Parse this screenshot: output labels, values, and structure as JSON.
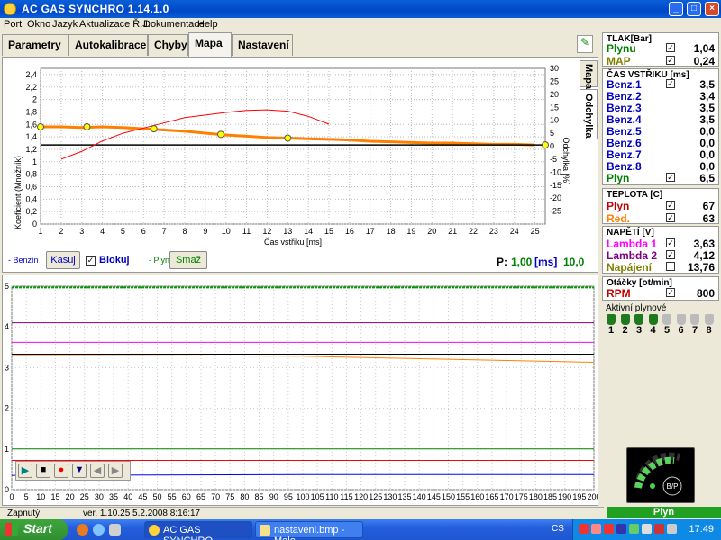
{
  "window": {
    "title": "AC GAS SYNCHRO    1.14.1.0"
  },
  "menu": [
    "Port",
    "Okno",
    "Jazyk",
    "Aktualizace Ř.J.",
    "Dokumentace",
    "Help"
  ],
  "tabs": [
    {
      "label": "Parametry",
      "active": false
    },
    {
      "label": "Autokalibrace",
      "active": false
    },
    {
      "label": "Chyby",
      "active": false
    },
    {
      "label": "Mapa",
      "active": true
    },
    {
      "label": "Nastavení",
      "active": false
    }
  ],
  "side_tabs": [
    "Mapa",
    "Odchylka"
  ],
  "map": {
    "y_label": "Koeficient (Množník)",
    "y2_label": "Odchylka [%]",
    "x_label": "Čas vstřiku [ms]",
    "y_ticks": [
      "2,4",
      "2,2",
      "2",
      "1,8",
      "1,6",
      "1,4",
      "1,2",
      "1",
      "0,8",
      "0,6",
      "0,4",
      "0,2",
      "0"
    ],
    "y2_ticks": [
      "30",
      "25",
      "20",
      "15",
      "10",
      "5",
      "0",
      "-5",
      "-10",
      "-15",
      "-20",
      "-25"
    ],
    "x_ticks": [
      "1",
      "2",
      "3",
      "4",
      "5",
      "6",
      "7",
      "8",
      "9",
      "10",
      "11",
      "12",
      "13",
      "14",
      "15",
      "16",
      "17",
      "18",
      "19",
      "20",
      "21",
      "22",
      "23",
      "24",
      "25"
    ],
    "benzin_label": "- Benzín",
    "kasuj_label": "Kasuj",
    "blokuj_label": "Blokuj",
    "plyn_label": "- Plyn",
    "smaz_label": "Smaž",
    "readout_label": "P:",
    "readout_value": "1,00",
    "readout_unit": "[ms]",
    "readout_value2": "10,0"
  },
  "chart_data": [
    {
      "type": "line",
      "xlabel": "Čas vstřiku [ms]",
      "ylabel": "Koeficient (Množník)",
      "y2label": "Odchylka [%]",
      "xlim": [
        1,
        25.5
      ],
      "ylim": [
        0,
        2.5
      ],
      "y2lim": [
        -30,
        30
      ],
      "grid": true,
      "series": [
        {
          "axis": "y",
          "color": "#ff8000",
          "x": [
            1,
            2,
            3,
            4,
            5,
            6,
            7,
            8,
            9,
            10,
            11,
            12,
            13,
            14,
            15,
            16,
            17,
            18,
            19,
            20,
            21,
            22,
            23,
            24,
            25
          ],
          "y": [
            1.56,
            1.56,
            1.55,
            1.56,
            1.55,
            1.53,
            1.51,
            1.49,
            1.46,
            1.43,
            1.41,
            1.39,
            1.38,
            1.37,
            1.36,
            1.35,
            1.33,
            1.32,
            1.31,
            1.3,
            1.3,
            1.29,
            1.28,
            1.28,
            1.27
          ]
        },
        {
          "axis": "y",
          "color": "#000000",
          "x": [
            1,
            25.5
          ],
          "y": [
            1.27,
            1.27
          ]
        },
        {
          "axis": "y2",
          "color": "#ff0000",
          "x": [
            2,
            3,
            4,
            5,
            6,
            7,
            8,
            9,
            10,
            11,
            12,
            13,
            14,
            15
          ],
          "y": [
            -5,
            -2,
            2,
            5,
            7,
            9,
            11,
            12,
            13,
            13.8,
            14,
            13.5,
            11.5,
            8.5
          ]
        }
      ],
      "points": [
        {
          "x": 1,
          "y": 1.56
        },
        {
          "x": 3.25,
          "y": 1.56
        },
        {
          "x": 6.5,
          "y": 1.53
        },
        {
          "x": 9.75,
          "y": 1.44
        },
        {
          "x": 13,
          "y": 1.38
        },
        {
          "x": 25.5,
          "y": 1.27
        }
      ]
    },
    {
      "type": "line",
      "ylim": [
        0,
        5
      ],
      "xlim": [
        0,
        200
      ],
      "x_ticks": [
        "0",
        "5",
        "10",
        "15",
        "20",
        "25",
        "30",
        "35",
        "40",
        "45",
        "50",
        "55",
        "60",
        "65",
        "70",
        "75",
        "80",
        "85",
        "90",
        "95",
        "100",
        "105",
        "110",
        "115",
        "120",
        "125",
        "130",
        "135",
        "140",
        "145",
        "150",
        "155",
        "160",
        "165",
        "170",
        "175",
        "180",
        "185",
        "190",
        "195",
        "200"
      ],
      "y_ticks": [
        "5",
        "4",
        "3",
        "2",
        "1",
        "0"
      ],
      "series": [
        {
          "color": "#800080",
          "values": [
            4.1,
            4.1,
            4.1
          ]
        },
        {
          "color": "#ff00ff",
          "values": [
            3.62,
            3.62,
            3.62
          ]
        },
        {
          "color": "#000000",
          "values": [
            3.33,
            3.33,
            3.33
          ]
        },
        {
          "color": "#ff8000",
          "values": [
            3.3,
            3.28,
            3.13
          ]
        },
        {
          "color": "#008000",
          "values": [
            1.0,
            1.0,
            1.0
          ]
        },
        {
          "color": "#ff0000",
          "values": [
            0.72,
            0.72,
            0.72
          ]
        },
        {
          "color": "#0000ff",
          "values": [
            0.35,
            0.37,
            0.37
          ]
        },
        {
          "color": "#00a000",
          "values": [
            4.97,
            4.97,
            4.97
          ]
        }
      ]
    }
  ],
  "tlak": {
    "header": "TLAK[Bar]",
    "rows": [
      {
        "label": "Plynu",
        "color": "#008000",
        "checked": true,
        "value": "1,04"
      },
      {
        "label": "MAP",
        "color": "#808000",
        "checked": true,
        "value": "0,24"
      }
    ]
  },
  "cas": {
    "header": "ČAS VSTŘIKU  [ms]",
    "rows": [
      {
        "label": "Benz.1",
        "color": "#0000c0",
        "checked": true,
        "value": "3,5"
      },
      {
        "label": "Benz.2",
        "color": "#0000c0",
        "checked": null,
        "value": "3,4"
      },
      {
        "label": "Benz.3",
        "color": "#0000c0",
        "checked": null,
        "value": "3,5"
      },
      {
        "label": "Benz.4",
        "color": "#0000c0",
        "checked": null,
        "value": "3,5"
      },
      {
        "label": "Benz.5",
        "color": "#0000c0",
        "checked": null,
        "value": "0,0"
      },
      {
        "label": "Benz.6",
        "color": "#0000c0",
        "checked": null,
        "value": "0,0"
      },
      {
        "label": "Benz.7",
        "color": "#0000c0",
        "checked": null,
        "value": "0,0"
      },
      {
        "label": "Benz.8",
        "color": "#0000c0",
        "checked": null,
        "value": "0,0"
      },
      {
        "label": "Plyn",
        "color": "#008000",
        "checked": true,
        "value": "6,5"
      }
    ]
  },
  "teplota": {
    "header": "TEPLOTA  [C]",
    "rows": [
      {
        "label": "Plyn",
        "color": "#c00000",
        "checked": true,
        "value": "67"
      },
      {
        "label": "Red.",
        "color": "#ff8000",
        "checked": true,
        "value": "63"
      }
    ]
  },
  "napeti": {
    "header": "NAPĚTÍ [V]",
    "rows": [
      {
        "label": "Lambda 1",
        "color": "#ff00ff",
        "checked": true,
        "value": "3,63"
      },
      {
        "label": "Lambda 2",
        "color": "#800080",
        "checked": true,
        "value": "4,12"
      },
      {
        "label": "Napájení",
        "color": "#808000",
        "checked": false,
        "value": "13,76"
      }
    ]
  },
  "otacky": {
    "header": "Otáčky [ot/min]",
    "rows": [
      {
        "label": "RPM",
        "color": "#c00000",
        "checked": true,
        "value": "800"
      }
    ]
  },
  "injectors": {
    "header": "Aktivní plynové",
    "items": [
      "1",
      "2",
      "3",
      "4",
      "5",
      "6",
      "7",
      "8"
    ],
    "active": [
      true,
      true,
      true,
      true,
      false,
      false,
      false,
      false
    ]
  },
  "indicator": {
    "label": "B/P"
  },
  "statusbar": {
    "state": "Zapnutý",
    "version": "ver. 1.10.25   5.2.2008  8:16:17"
  },
  "status_gas": "Plyn",
  "taskbar": {
    "start": "Start",
    "items": [
      {
        "label": "AC GAS SYNCHRO",
        "active": true
      },
      {
        "label": "nastaveni.bmp - Malo...",
        "active": false
      }
    ],
    "lang": "CS",
    "clock": "17:49"
  }
}
